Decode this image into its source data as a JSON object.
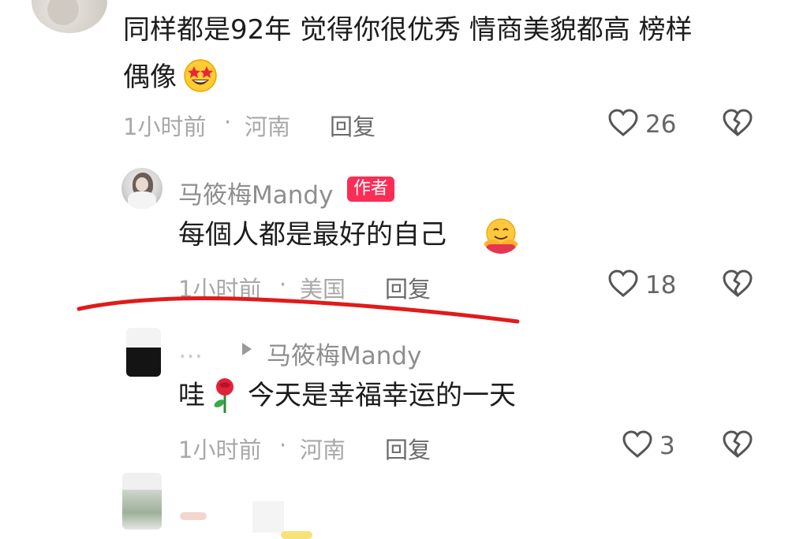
{
  "comment1": {
    "text_line1": "同样都是92年 觉得你很优秀 情商美貌都高 榜样",
    "text_line2": "偶像",
    "emoji": "star-struck-emoji",
    "time": "1小时前",
    "location": "河南",
    "reply_label": "回复",
    "likes": "26"
  },
  "comment2": {
    "username": "马筱梅Mandy",
    "badge": "作者",
    "text": "每個人都是最好的自己",
    "emoji": "hugging-face-emoji",
    "time": "1小时前",
    "location": "美国",
    "reply_label": "回复",
    "likes": "18"
  },
  "comment3": {
    "reply_to": "马筱梅Mandy",
    "text_before": "哇",
    "emoji": "rose-emoji",
    "text_after": "今天是幸福幸运的一天",
    "time": "1小时前",
    "location": "河南",
    "reply_label": "回复",
    "likes": "3"
  },
  "separator": "·",
  "colors": {
    "badge": "#fb2d55",
    "underline": "#e01b1b",
    "meta_text": "#a8a8a8"
  }
}
